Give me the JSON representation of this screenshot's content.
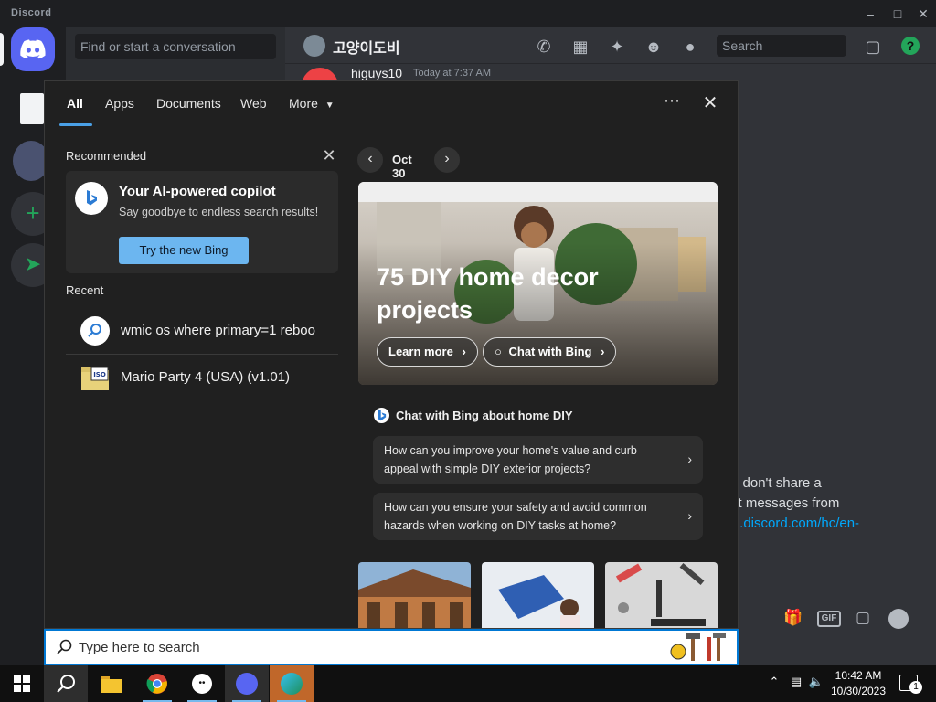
{
  "discord": {
    "app_title": "Discord",
    "find_placeholder": "Find or start a conversation",
    "channel_name": "고양이도비",
    "search_placeholder": "Search",
    "message": {
      "author": "higuys10",
      "time": "Today at 7:37 AM"
    },
    "notice_lines": [
      "u don't share a",
      "ct messages from",
      "rt.discord.com/hc/en-"
    ],
    "composer_icons": [
      "gift-icon",
      "gif-icon",
      "sticker-icon",
      "emoji-icon"
    ],
    "colors": {
      "blurple": "#5865f2",
      "bg": "#313338",
      "rail": "#1e1f22",
      "green": "#23a55a"
    }
  },
  "search_panel": {
    "tabs": [
      "All",
      "Apps",
      "Documents",
      "Web",
      "More"
    ],
    "active_tab": "All",
    "recommended": {
      "label": "Recommended",
      "card_title": "Your AI-powered copilot",
      "card_subtitle": "Say goodbye to endless search results!",
      "button": "Try the new Bing"
    },
    "recent": {
      "label": "Recent",
      "items": [
        {
          "icon": "search-icon",
          "text": "wmic os where primary=1 reboo"
        },
        {
          "icon": "iso-file-icon",
          "text": "Mario Party 4 (USA) (v1.01)"
        }
      ]
    },
    "date": "Oct 30",
    "hero": {
      "title": "75 DIY home decor projects",
      "learn_more": "Learn more",
      "chat_with_bing": "Chat with Bing"
    },
    "chat": {
      "heading": "Chat with Bing about home DIY",
      "prompts": [
        "How can you improve your home's value and curb appeal with simple DIY exterior projects?",
        "How can you ensure your safety and avoid common hazards when working on DIY tasks at home?"
      ]
    },
    "search_box_placeholder": "Type here to search",
    "accent": "#0078d4"
  },
  "taskbar": {
    "time": "10:42 AM",
    "date": "10/30/2023",
    "notification_count": "1"
  }
}
